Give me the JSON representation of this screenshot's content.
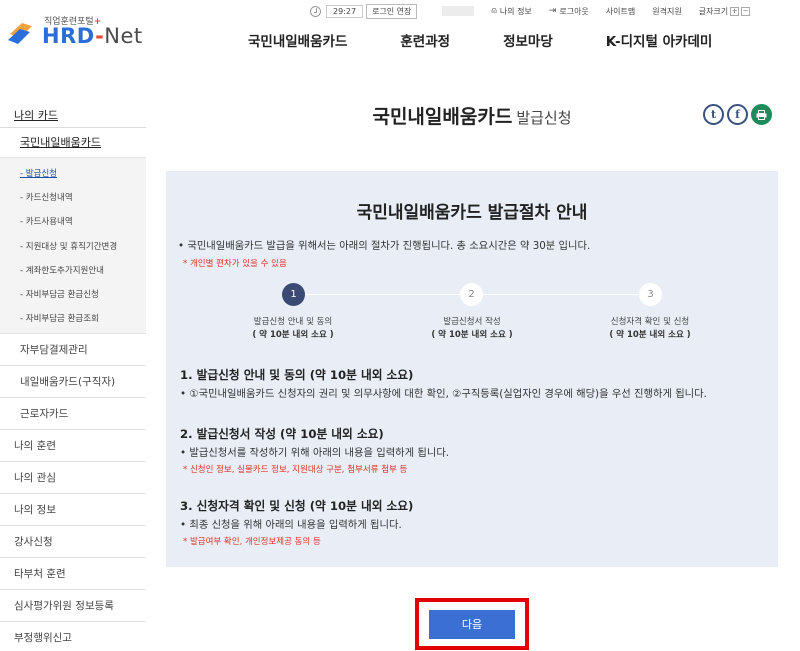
{
  "header": {
    "logo_sub": "직업훈련포털",
    "logo_plus": "+",
    "logo_hrd": "HRD",
    "logo_dash": "-",
    "logo_net": "Net",
    "timer": "29:27",
    "extend_login": "로그인 연장",
    "util_links": [
      "나의 정보",
      "로그아웃",
      "사이트맵",
      "원격지원",
      "글자크기"
    ],
    "font_plus": "+",
    "font_minus": "−",
    "gnb": [
      "국민내일배움카드",
      "훈련과정",
      "정보마당",
      "K-디지털 아카데미"
    ]
  },
  "sidebar": {
    "top": "나의 카드",
    "sub": "국민내일배움카드",
    "leaves": [
      "- 발급신청",
      "- 카드신청내역",
      "- 카드사용내역",
      "- 지원대상 및 휴직기간변경",
      "- 계좌한도추가지원안내",
      "- 자비부담금 환급신청",
      "- 자비부담금 환급조회"
    ],
    "active_leaf": 0,
    "groups": [
      "자부담결제관리",
      "내일배움카드(구직자)",
      "근로자카드"
    ],
    "main": [
      "나의 훈련",
      "나의 관심",
      "나의 정보",
      "강사신청",
      "타부처 훈련",
      "심사평가위원 정보등록",
      "부정행위신고"
    ]
  },
  "page": {
    "title": "국민내일배움카드",
    "title_sub": "발급신청",
    "share": [
      "t",
      "f",
      "print"
    ]
  },
  "guide": {
    "title": "국민내일배움카드 발급절차 안내",
    "intro": "• 국민내일배움카드 발급을 위해서는 아래의 절차가 진행됩니다. 총 소요시간은 약 30분 입니다.",
    "intro_note": "* 개인별 편차가 있을 수 있음",
    "steps": [
      {
        "num": "1",
        "label": "발급신청 안내 및 동의",
        "time": "( 약 10분 내외 소요 )"
      },
      {
        "num": "2",
        "label": "발급신청서 작성",
        "time": "( 약 10분 내외 소요 )"
      },
      {
        "num": "3",
        "label": "신청자격 확인 및 신청",
        "time": "( 약 10분 내외 소요 )"
      }
    ],
    "active_step": 0,
    "sections": [
      {
        "title": "1. 발급신청 안내 및 동의 (약 10분 내외 소요)",
        "desc": "• ①국민내일배움카드 신청자의 권리 및 의무사항에 대한 확인, ②구직등록(실업자인 경우에 해당)을 우선 진행하게 됩니다.",
        "note": ""
      },
      {
        "title": "2. 발급신청서 작성 (약 10분 내외 소요)",
        "desc": "• 발급신청서를 작성하기 위해 아래의 내용을 입력하게 됩니다.",
        "note": "* 신청인 정보, 실물카드 정보, 지원대상 구분, 첨부서류 첨부 등"
      },
      {
        "title": "3. 신청자격 확인 및 신청 (약 10분 내외 소요)",
        "desc": "• 최종 신청을 위해 아래의 내용을 입력하게 됩니다.",
        "note": "* 발급여부 확인, 개인정보제공 동의 등"
      }
    ]
  },
  "next_button": "다음",
  "colors": {
    "brand_blue": "#2a6ed9",
    "brand_orange": "#e64a2e",
    "guide_bg": "#e9eef6",
    "step_active": "#3b4a73",
    "note_red": "#e0332b",
    "button_blue": "#3c6fd4",
    "highlight_red": "#e50000"
  }
}
